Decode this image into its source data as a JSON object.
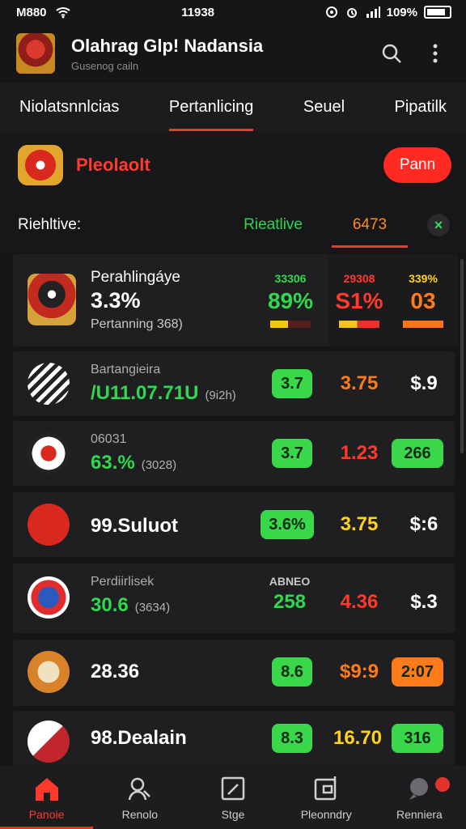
{
  "status_bar": {
    "time_left": "M880",
    "time_center": "11938",
    "battery": "109%"
  },
  "header": {
    "title": "Olahrag Glp! Nadansia",
    "subtitle": "Gusenog cailn"
  },
  "tabs": [
    {
      "label": "Niolatsnnlcias"
    },
    {
      "label": "Pertanlicing"
    },
    {
      "label": "Seuel"
    },
    {
      "label": "Pipatilk"
    }
  ],
  "promo": {
    "title": "Pleolaolt",
    "button_label": "Pann"
  },
  "filter": {
    "label": "Riehltive:",
    "green_label": "Rieatlive",
    "orange_label": "6473",
    "close_label": "×"
  },
  "rows": [
    {
      "type": "featured",
      "name": "Perahlingáye",
      "value": "3.3%",
      "subtitle": "Pertanning 368)",
      "stats": [
        {
          "small": "33306",
          "big": "89%",
          "bar_fill": 1.0
        },
        {
          "small": "29308",
          "big": "S1%",
          "bar_fill": 0.75
        },
        {
          "small": "339%",
          "big": "03",
          "bar_fill": 1.0
        }
      ]
    },
    {
      "type": "standard",
      "subtitle": "Bartangieira",
      "main": "/U11.07.71U",
      "paren": "(9i2h)",
      "pill": "3.7",
      "value_a": "3.75",
      "value_b": "$.9"
    },
    {
      "type": "standard",
      "subtitle": "06031",
      "main": "63.%",
      "paren": "(3028)",
      "pill": "3.7",
      "value_a": "1.23",
      "value_b": "266"
    },
    {
      "type": "single",
      "main": "99.Suluot",
      "pill": "3.6%",
      "value_a": "3.75",
      "value_b": "$:6"
    },
    {
      "type": "standard",
      "subtitle": "Perdiirlisek",
      "main": "30.6",
      "paren": "(3634)",
      "header": "ABNEO",
      "value_green": "258",
      "value_a": "4.36",
      "value_b": "$.3"
    },
    {
      "type": "single",
      "main": "28.36",
      "pill": "8.6",
      "value_a": "$9:9",
      "value_b": "2:07"
    },
    {
      "type": "single",
      "main": "98.Dealain",
      "pill": "8.3",
      "value_a": "16.70",
      "value_b": "316"
    }
  ],
  "nav": [
    {
      "label": "Panoie",
      "icon": "home-icon"
    },
    {
      "label": "Renolo",
      "icon": "profile-search-icon"
    },
    {
      "label": "Stge",
      "icon": "edit-icon"
    },
    {
      "label": "Pleonndry",
      "icon": "dashboard-icon"
    },
    {
      "label": "Renniera",
      "icon": "chat-icon"
    }
  ],
  "colors": {
    "accent": "#ff2a22",
    "green": "#2fd84e",
    "orange": "#ff7a1a",
    "yellow": "#ffd21c",
    "background": "#161618"
  }
}
